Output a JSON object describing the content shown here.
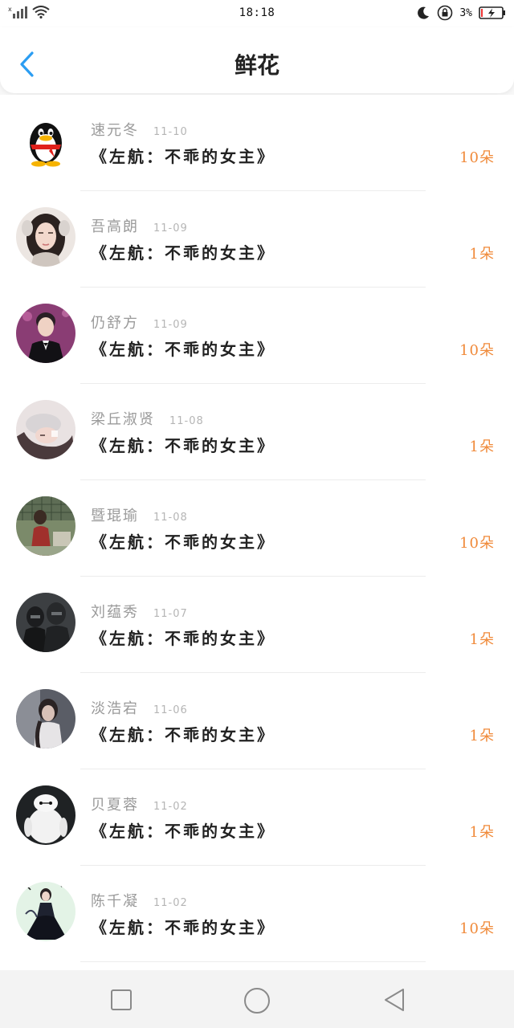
{
  "status_bar": {
    "time": "18:18",
    "battery_percent": "3%",
    "icons": [
      "signal-icon",
      "wifi-icon",
      "moon-icon",
      "rotation-lock-icon",
      "battery-charging-icon"
    ]
  },
  "header": {
    "title": "鲜花",
    "back_icon": "chevron-left-icon"
  },
  "colors": {
    "accent_blue": "#2b9df2",
    "count_orange": "#f08a3a",
    "name_gray": "#9a9a9a"
  },
  "list": [
    {
      "name": "速元冬",
      "date": "11-10",
      "book": "《左航：不乖的女主》",
      "count": "10朵",
      "avatar": "qq-penguin"
    },
    {
      "name": "吾高朗",
      "date": "11-09",
      "book": "《左航：不乖的女主》",
      "count": "1朵",
      "avatar": "girl-headphones"
    },
    {
      "name": "仍舒方",
      "date": "11-09",
      "book": "《左航：不乖的女主》",
      "count": "10朵",
      "avatar": "boy-suit"
    },
    {
      "name": "梁丘淑贤",
      "date": "11-08",
      "book": "《左航：不乖的女主》",
      "count": "1朵",
      "avatar": "girl-lying"
    },
    {
      "name": "暨琨瑜",
      "date": "11-08",
      "book": "《左航：不乖的女主》",
      "count": "10朵",
      "avatar": "boy-outdoor"
    },
    {
      "name": "刘蕴秀",
      "date": "11-07",
      "book": "《左航：不乖的女主》",
      "count": "1朵",
      "avatar": "soldiers-dark"
    },
    {
      "name": "淡浩宕",
      "date": "11-06",
      "book": "《左航：不乖的女主》",
      "count": "1朵",
      "avatar": "girl-dark"
    },
    {
      "name": "贝夏蓉",
      "date": "11-02",
      "book": "《左航：不乖的女主》",
      "count": "1朵",
      "avatar": "baymax"
    },
    {
      "name": "陈千凝",
      "date": "11-02",
      "book": "《左航：不乖的女主》",
      "count": "10朵",
      "avatar": "girl-black-dress"
    }
  ],
  "nav_bar": {
    "icons": [
      "square-icon",
      "circle-icon",
      "triangle-back-icon"
    ]
  }
}
